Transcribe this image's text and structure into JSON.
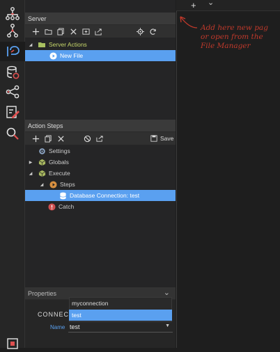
{
  "rail": {
    "icons": [
      "sitemap-icon",
      "routes-icon",
      "server-connect-icon",
      "database-icon",
      "share-icon",
      "edit-icon",
      "search-icon",
      "bottom-icon"
    ]
  },
  "editor": {
    "add_symbol": "+",
    "chevron_symbol": "⌄",
    "hint_text": "Add here new pag\nor open from the\nFile Manager"
  },
  "server_panel": {
    "title": "Server",
    "tree": [
      {
        "label": "Server Actions",
        "color": "#c8d86a"
      },
      {
        "label": "New File",
        "color": "#ffffff"
      }
    ]
  },
  "steps_panel": {
    "title": "Action Steps",
    "save_label": "Save",
    "tree": [
      {
        "label": "Settings"
      },
      {
        "label": "Globals"
      },
      {
        "label": "Execute"
      },
      {
        "label": "Steps"
      },
      {
        "label": "Database Connection: test"
      },
      {
        "label": "Catch"
      }
    ]
  },
  "properties": {
    "title": "Properties",
    "section_label": "CONNECT",
    "name_label": "Name",
    "name_value": "test",
    "dropdown_options": [
      "myconnection",
      "test"
    ],
    "selected_option": "test"
  },
  "colors": {
    "accent": "#5aa0f0",
    "brand_red": "#e05050",
    "hint_red": "#c0392b",
    "folder_green": "#a8c060"
  }
}
